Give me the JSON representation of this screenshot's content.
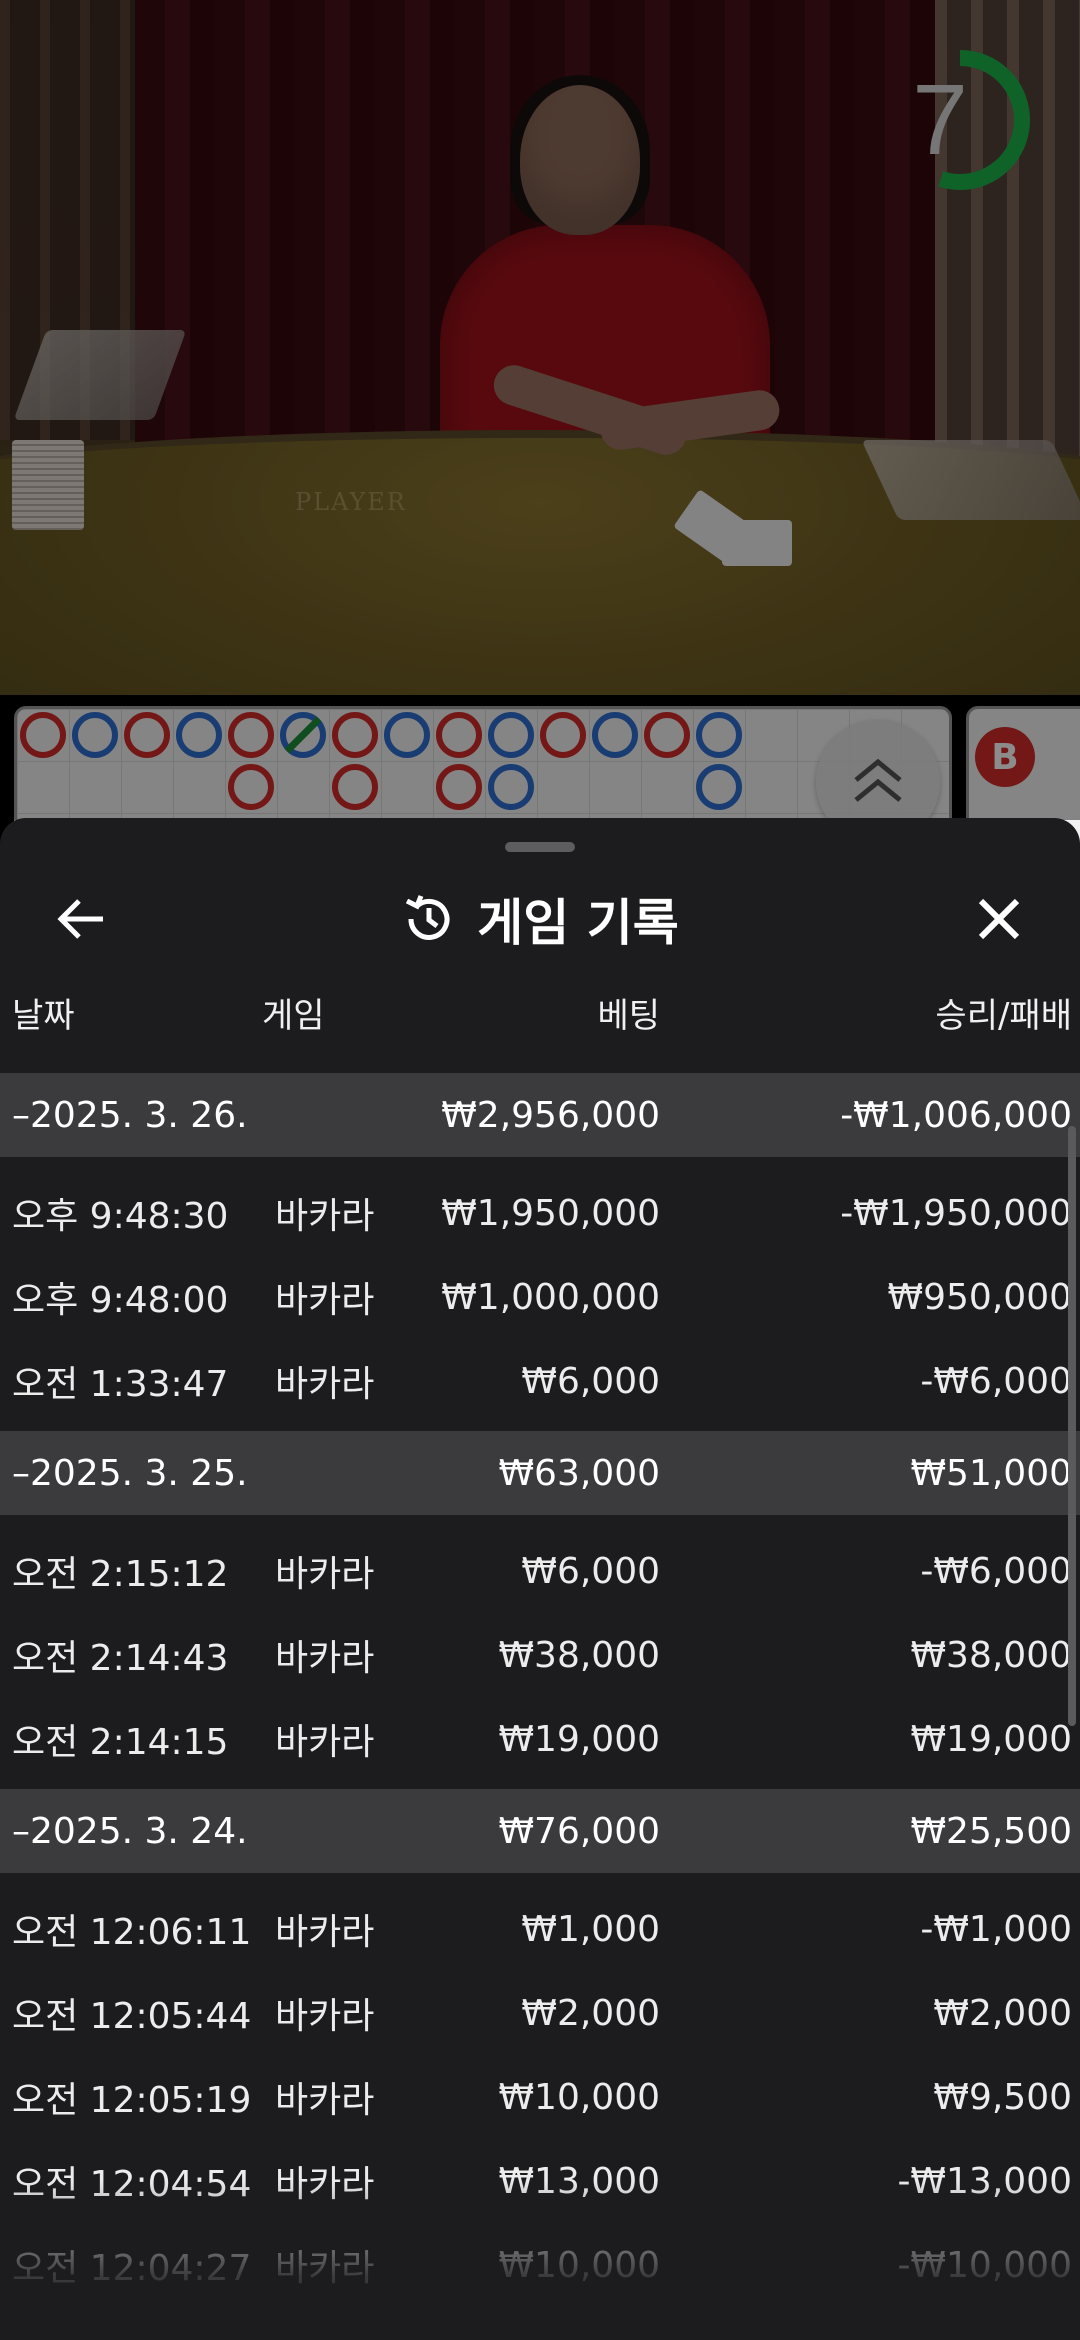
{
  "video": {
    "table_label": "PLAYER",
    "countdown": "7",
    "countdown_fraction": 0.55,
    "timer_color": "#1db34a"
  },
  "roadmap": {
    "red": "#d22b2b",
    "blue": "#2f6ed1",
    "tie": "#1e8c3a",
    "row1": [
      "P",
      "B",
      "P",
      "B",
      "P",
      "B",
      "P",
      "B",
      "P",
      "B",
      "P",
      "B",
      "P",
      "B"
    ],
    "row2": [
      "",
      "",
      "",
      "",
      "P",
      "",
      "P",
      "",
      "P",
      "B",
      "",
      "",
      "",
      "B"
    ],
    "side_bead_label": "B"
  },
  "sheet": {
    "title": "게임 기록",
    "columns": {
      "date": "날짜",
      "game": "게임",
      "bet": "베팅",
      "win_loss": "승리/패배"
    },
    "groups": [
      {
        "date": "–2025. 3. 26.",
        "bet": "₩2,956,000",
        "result": "-₩1,006,000",
        "rows": [
          {
            "time": "오후 9:48:30",
            "game": "바카라",
            "bet": "₩1,950,000",
            "result": "-₩1,950,000"
          },
          {
            "time": "오후 9:48:00",
            "game": "바카라",
            "bet": "₩1,000,000",
            "result": "₩950,000"
          },
          {
            "time": "오전 1:33:47",
            "game": "바카라",
            "bet": "₩6,000",
            "result": "-₩6,000"
          }
        ]
      },
      {
        "date": "–2025. 3. 25.",
        "bet": "₩63,000",
        "result": "₩51,000",
        "rows": [
          {
            "time": "오전 2:15:12",
            "game": "바카라",
            "bet": "₩6,000",
            "result": "-₩6,000"
          },
          {
            "time": "오전 2:14:43",
            "game": "바카라",
            "bet": "₩38,000",
            "result": "₩38,000"
          },
          {
            "time": "오전 2:14:15",
            "game": "바카라",
            "bet": "₩19,000",
            "result": "₩19,000"
          }
        ]
      },
      {
        "date": "–2025. 3. 24.",
        "bet": "₩76,000",
        "result": "₩25,500",
        "rows": [
          {
            "time": "오전 12:06:11",
            "game": "바카라",
            "bet": "₩1,000",
            "result": "-₩1,000"
          },
          {
            "time": "오전 12:05:44",
            "game": "바카라",
            "bet": "₩2,000",
            "result": "₩2,000"
          },
          {
            "time": "오전 12:05:19",
            "game": "바카라",
            "bet": "₩10,000",
            "result": "₩9,500"
          },
          {
            "time": "오전 12:04:54",
            "game": "바카라",
            "bet": "₩13,000",
            "result": "-₩13,000"
          },
          {
            "time": "오전 12:04:27",
            "game": "바카라",
            "bet": "₩10,000",
            "result": "-₩10,000"
          }
        ]
      }
    ]
  }
}
